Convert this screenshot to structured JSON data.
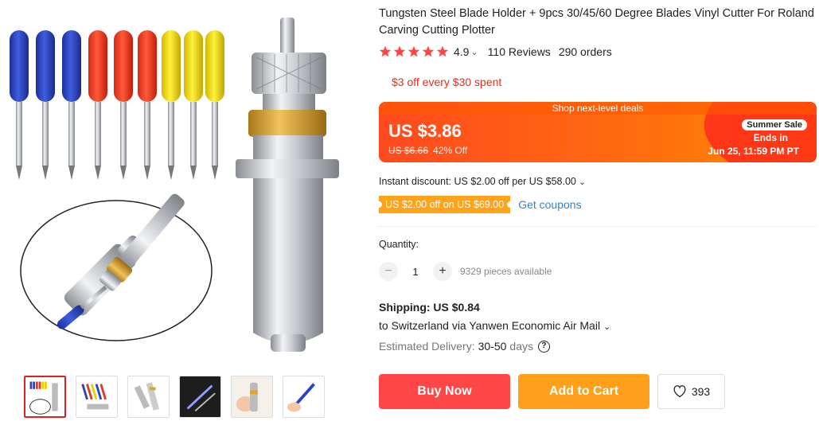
{
  "product": {
    "title": "Tungsten Steel Blade Holder + 9pcs 30/45/60 Degree Blades Vinyl Cutter For Roland Carving Cutting Plotter"
  },
  "rating": {
    "value": "4.9",
    "reviews": "110 Reviews",
    "orders": "290 orders",
    "star_color": "#ff4747"
  },
  "promo": {
    "text": "$3 off every $30 spent"
  },
  "deal": {
    "header": "Shop next-level deals",
    "price": "US $3.86",
    "old_price": "US $6.66",
    "discount": "42% Off",
    "badge": "Summer Sale",
    "ends_label": "Ends in",
    "ends_date": "Jun 25, 11:59 PM PT"
  },
  "instant_discount": {
    "text": "Instant discount: US $2.00 off per US $58.00"
  },
  "coupon": {
    "text": "US $2.00 off on US $69.00",
    "link": "Get coupons"
  },
  "quantity": {
    "label": "Quantity:",
    "minus": "−",
    "value": "1",
    "plus": "+",
    "available": "9329 pieces available"
  },
  "shipping": {
    "price": "Shipping: US $0.84",
    "destination": "to Switzerland via Yanwen Economic Air Mail",
    "delivery_label": "Estimated Delivery:",
    "delivery_value": "30-50",
    "delivery_unit": "days",
    "help": "?"
  },
  "actions": {
    "buy_now": "Buy Now",
    "add_to_cart": "Add to Cart",
    "wishlist_count": "393"
  },
  "colors": {
    "buy": "#ff4747",
    "cart": "#ff9f1a",
    "link": "#2f86c8",
    "coupon": "#ffa31a"
  }
}
